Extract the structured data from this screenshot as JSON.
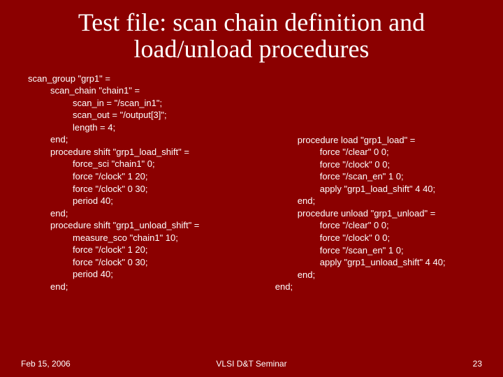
{
  "title": "Test file: scan chain definition and load/unload procedures",
  "left": [
    {
      "indent": 0,
      "text": "scan_group \"grp1\" ="
    },
    {
      "indent": 1,
      "text": "scan_chain \"chain1\" ="
    },
    {
      "indent": 2,
      "text": "scan_in = \"/scan_in1\";"
    },
    {
      "indent": 2,
      "text": "scan_out = \"/output[3]\";"
    },
    {
      "indent": 2,
      "text": "length = 4;"
    },
    {
      "indent": 1,
      "text": "end;"
    },
    {
      "indent": 1,
      "text": "procedure shift \"grp1_load_shift\" ="
    },
    {
      "indent": 2,
      "text": "force_sci \"chain1\" 0;"
    },
    {
      "indent": 2,
      "text": "force \"/clock\" 1 20;"
    },
    {
      "indent": 2,
      "text": "force \"/clock\" 0 30;"
    },
    {
      "indent": 2,
      "text": "period 40;"
    },
    {
      "indent": 1,
      "text": "end;"
    },
    {
      "indent": 1,
      "text": "procedure shift \"grp1_unload_shift\" ="
    },
    {
      "indent": 2,
      "text": "measure_sco \"chain1\" 10;"
    },
    {
      "indent": 2,
      "text": "force \"/clock\" 1 20;"
    },
    {
      "indent": 2,
      "text": "force \"/clock\" 0 30;"
    },
    {
      "indent": 2,
      "text": "period 40;"
    },
    {
      "indent": 1,
      "text": "end;"
    }
  ],
  "right": [
    {
      "indent": 1,
      "text": "procedure load \"grp1_load\" ="
    },
    {
      "indent": 2,
      "text": "force \"/clear\" 0 0;"
    },
    {
      "indent": 2,
      "text": "force \"/clock\" 0 0;"
    },
    {
      "indent": 2,
      "text": "force \"/scan_en\" 1 0;"
    },
    {
      "indent": 2,
      "text": "apply \"grp1_load_shift\" 4 40;"
    },
    {
      "indent": 1,
      "text": "end;"
    },
    {
      "indent": 1,
      "text": "procedure unload \"grp1_unload\" ="
    },
    {
      "indent": 2,
      "text": "force \"/clear\" 0 0;"
    },
    {
      "indent": 2,
      "text": "force \"/clock\" 0 0;"
    },
    {
      "indent": 2,
      "text": "force \"/scan_en\" 1 0;"
    },
    {
      "indent": 2,
      "text": "apply \"grp1_unload_shift\" 4 40;"
    },
    {
      "indent": 1,
      "text": "end;"
    },
    {
      "indent": 0,
      "text": "end;"
    }
  ],
  "footer": {
    "date": "Feb 15, 2006",
    "venue": "VLSI D&T Seminar",
    "page": "23"
  }
}
